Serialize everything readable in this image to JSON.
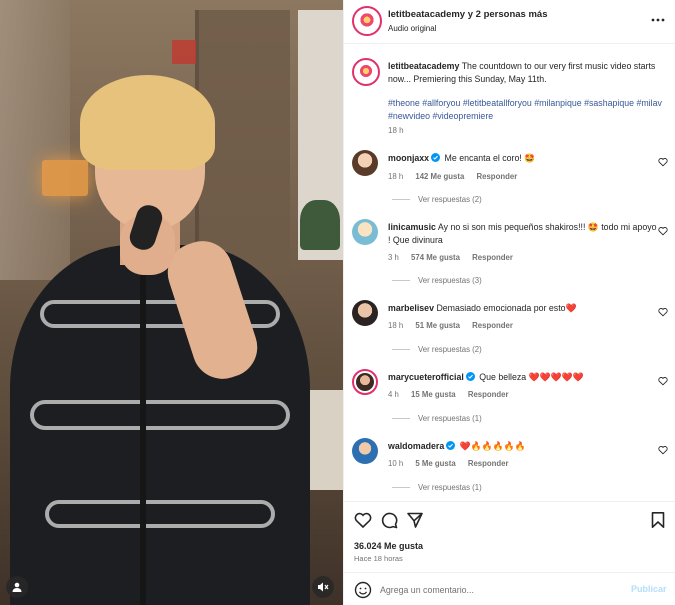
{
  "post": {
    "author": "letitbeatacademy",
    "collab_suffix": "y 2 personas más",
    "audio": "Audio original",
    "caption_user": "letitbeatacademy",
    "caption_text": "The countdown to our very first music video starts now... Premiering this Sunday, May 11th.",
    "hashtags": "#theone #allforyou #letitbeatallforyou #milanpique #sashapique #milav #newvideo #videopremiere",
    "caption_time": "18 h"
  },
  "comments": [
    {
      "user": "moonjaxx",
      "verified": true,
      "text": "Me encanta el coro! 🤩",
      "time": "18 h",
      "likes": "142 Me gusta",
      "reply": "Responder",
      "replies": "Ver respuestas (2)"
    },
    {
      "user": "linicamusic",
      "verified": false,
      "text": "Ay no si son mis pequeños shakiros!!! 🤩 todo mi apoyo ! Que divinura",
      "time": "3 h",
      "likes": "574 Me gusta",
      "reply": "Responder",
      "replies": "Ver respuestas (3)"
    },
    {
      "user": "marbelisev",
      "verified": false,
      "text": "Demasiado emocionada por esto❤️",
      "time": "18 h",
      "likes": "51 Me gusta",
      "reply": "Responder",
      "replies": "Ver respuestas (2)"
    },
    {
      "user": "marycueterofficial",
      "verified": true,
      "text": "Que belleza ❤️❤️❤️❤️❤️",
      "time": "4 h",
      "likes": "15 Me gusta",
      "reply": "Responder",
      "replies": "Ver respuestas (1)"
    },
    {
      "user": "waldomadera",
      "verified": true,
      "text": "❤️🔥🔥🔥🔥🔥",
      "time": "10 h",
      "likes": "5 Me gusta",
      "reply": "Responder",
      "replies": "Ver respuestas (1)"
    }
  ],
  "footer": {
    "likes": "36.024 Me gusta",
    "ago": "Hace 18 horas",
    "comment_placeholder": "Agrega un comentario...",
    "publish": "Publicar"
  },
  "colors": {
    "hashtag": "#385898",
    "muted": "#737373",
    "verified": "#0095f6",
    "publish_disabled": "#b2dffc"
  },
  "icons": [
    "more-icon",
    "heart-icon",
    "comment-icon",
    "share-icon",
    "save-icon",
    "smiley-icon",
    "mute-icon",
    "user-tag-icon",
    "verified-icon"
  ]
}
